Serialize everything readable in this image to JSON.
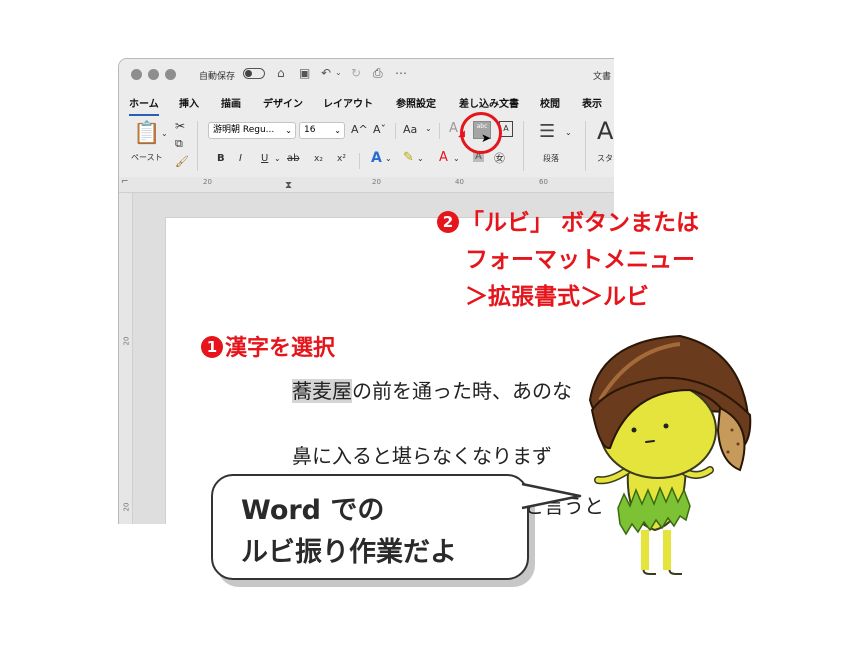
{
  "titlebar": {
    "autosave_label": "自動保存",
    "doc_title": "文書"
  },
  "menu": [
    "ホーム",
    "挿入",
    "描画",
    "デザイン",
    "レイアウト",
    "参照設定",
    "差し込み文書",
    "校閲",
    "表示"
  ],
  "ribbon": {
    "paste_label": "ペースト",
    "font_name": "游明朝 Regu...",
    "font_size": "16",
    "grow_font": "A^",
    "shrink_font": "Aˇ",
    "change_case": "Aa",
    "bold": "B",
    "italic": "I",
    "underline": "U",
    "strike": "ab",
    "subscript": "x₂",
    "superscript": "x²",
    "ruby_glyph": "abc",
    "paragraph_label": "段落",
    "styles_label": "スタ"
  },
  "ruler": {
    "h_ticks": [
      "20",
      "20",
      "40",
      "60"
    ],
    "v_ticks": [
      "20",
      "20"
    ]
  },
  "document": {
    "line1_selected": "蕎麦屋",
    "line1_rest": "の前を通った時、あのな",
    "line2": "鼻に入ると堪らなくなりまず",
    "line3": "と言うと"
  },
  "callouts": {
    "step1_badge": "1",
    "step1_text": "漢字を選択",
    "step2_badge": "2",
    "step2_line1": "「ルビ」 ボタンまたは",
    "step2_line2": "フォーマットメニュー",
    "step2_line3": "＞拡張書式＞ルビ"
  },
  "bubble": {
    "line1": "Word での",
    "line2": "ルビ振り作業だよ"
  },
  "colors": {
    "accent_red": "#e5151b",
    "tab_underline": "#2b5fb4",
    "mascot_body": "#e5e43c",
    "mascot_cap": "#6b3b1e",
    "mascot_skirt": "#7cc234"
  }
}
